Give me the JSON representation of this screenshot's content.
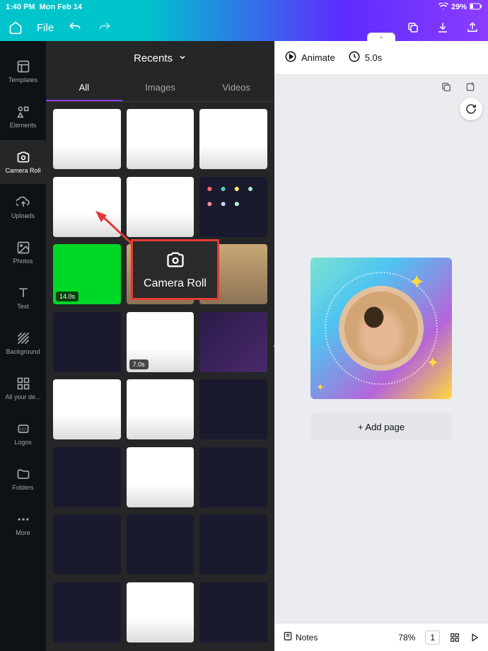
{
  "status": {
    "time": "1:40 PM",
    "date": "Mon Feb 14",
    "battery": "29%"
  },
  "toolbar": {
    "file_label": "File"
  },
  "sidebar": {
    "items": [
      {
        "icon": "templates",
        "label": "Templates"
      },
      {
        "icon": "elements",
        "label": "Elements"
      },
      {
        "icon": "camera",
        "label": "Camera Roll"
      },
      {
        "icon": "uploads",
        "label": "Uploads"
      },
      {
        "icon": "photos",
        "label": "Photos"
      },
      {
        "icon": "text",
        "label": "Text"
      },
      {
        "icon": "background",
        "label": "Background"
      },
      {
        "icon": "designs",
        "label": "All your de..."
      },
      {
        "icon": "logos",
        "label": "Logos"
      },
      {
        "icon": "folders",
        "label": "Folders"
      },
      {
        "icon": "more",
        "label": "More"
      }
    ],
    "active_index": 2
  },
  "panel": {
    "header": "Recents",
    "tabs": [
      "All",
      "Images",
      "Videos"
    ],
    "active_tab": 0,
    "thumbnails": [
      {
        "style": "mix"
      },
      {
        "style": "mix"
      },
      {
        "style": "mix"
      },
      {
        "style": "mix"
      },
      {
        "style": "mix"
      },
      {
        "style": "apps"
      },
      {
        "style": "green",
        "duration": "14.0s"
      },
      {
        "style": "photo"
      },
      {
        "style": "photo"
      },
      {
        "style": "dark"
      },
      {
        "style": "mix",
        "duration": "7.0s"
      },
      {
        "style": "purple"
      },
      {
        "style": "mix"
      },
      {
        "style": "mix"
      },
      {
        "style": "dark"
      },
      {
        "style": "dark"
      },
      {
        "style": "mix"
      },
      {
        "style": "dark"
      },
      {
        "style": "dark"
      },
      {
        "style": "dark"
      },
      {
        "style": "dark"
      },
      {
        "style": "dark"
      },
      {
        "style": "mix"
      },
      {
        "style": "dark"
      }
    ]
  },
  "callout": {
    "label": "Camera Roll"
  },
  "canvas": {
    "animate_label": "Animate",
    "duration_label": "5.0s",
    "add_page_label": "+ Add page"
  },
  "bottom": {
    "notes_label": "Notes",
    "zoom": "78%",
    "page_count": "1"
  }
}
